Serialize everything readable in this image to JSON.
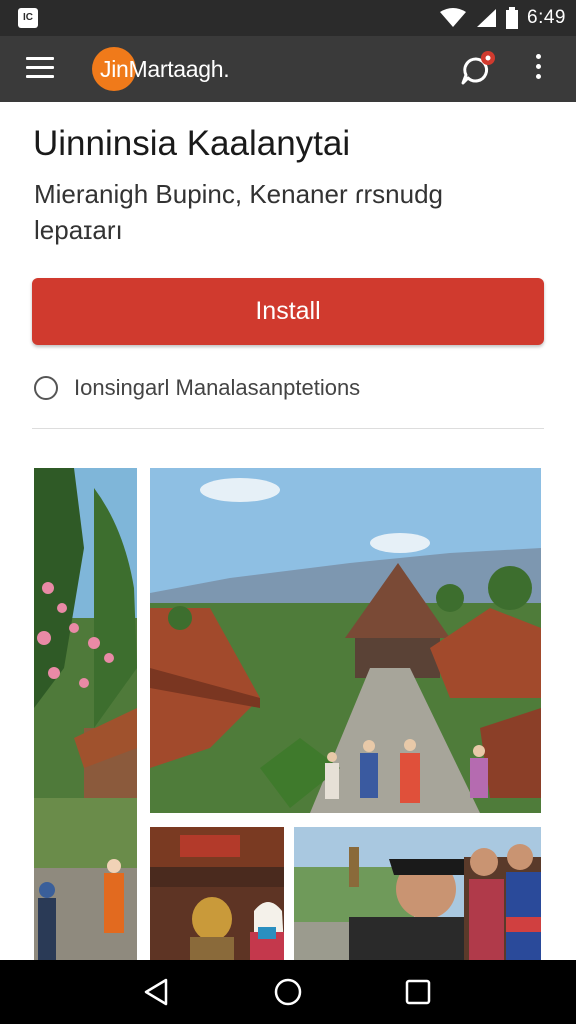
{
  "status_bar": {
    "time": "6:49",
    "icons": [
      "app-notification-icon",
      "wifi-icon",
      "signal-icon",
      "battery-icon"
    ]
  },
  "app_bar": {
    "title": "JinMartaagh.",
    "icons": [
      "menu-icon",
      "chat-icon",
      "more-vertical-icon"
    ],
    "logo_color": "#f07a1a",
    "background": "#3a3a3a"
  },
  "content": {
    "title": "Uinninsia Kaalanytai",
    "subtitle": "Mieranigh Bupinc, Kenaner ɾrsnudg lepaɪarı",
    "install_label": "Install",
    "install_color": "#d03a2e",
    "option_label": "Ionsingarl Manalasanptetions"
  },
  "photos": {
    "items": [
      "village-flowers-photo",
      "village-street-photo",
      "interior-woman-photo",
      "man-portrait-photo"
    ]
  },
  "nav_bar": {
    "icons": [
      "back-icon",
      "home-icon",
      "recents-icon"
    ]
  }
}
